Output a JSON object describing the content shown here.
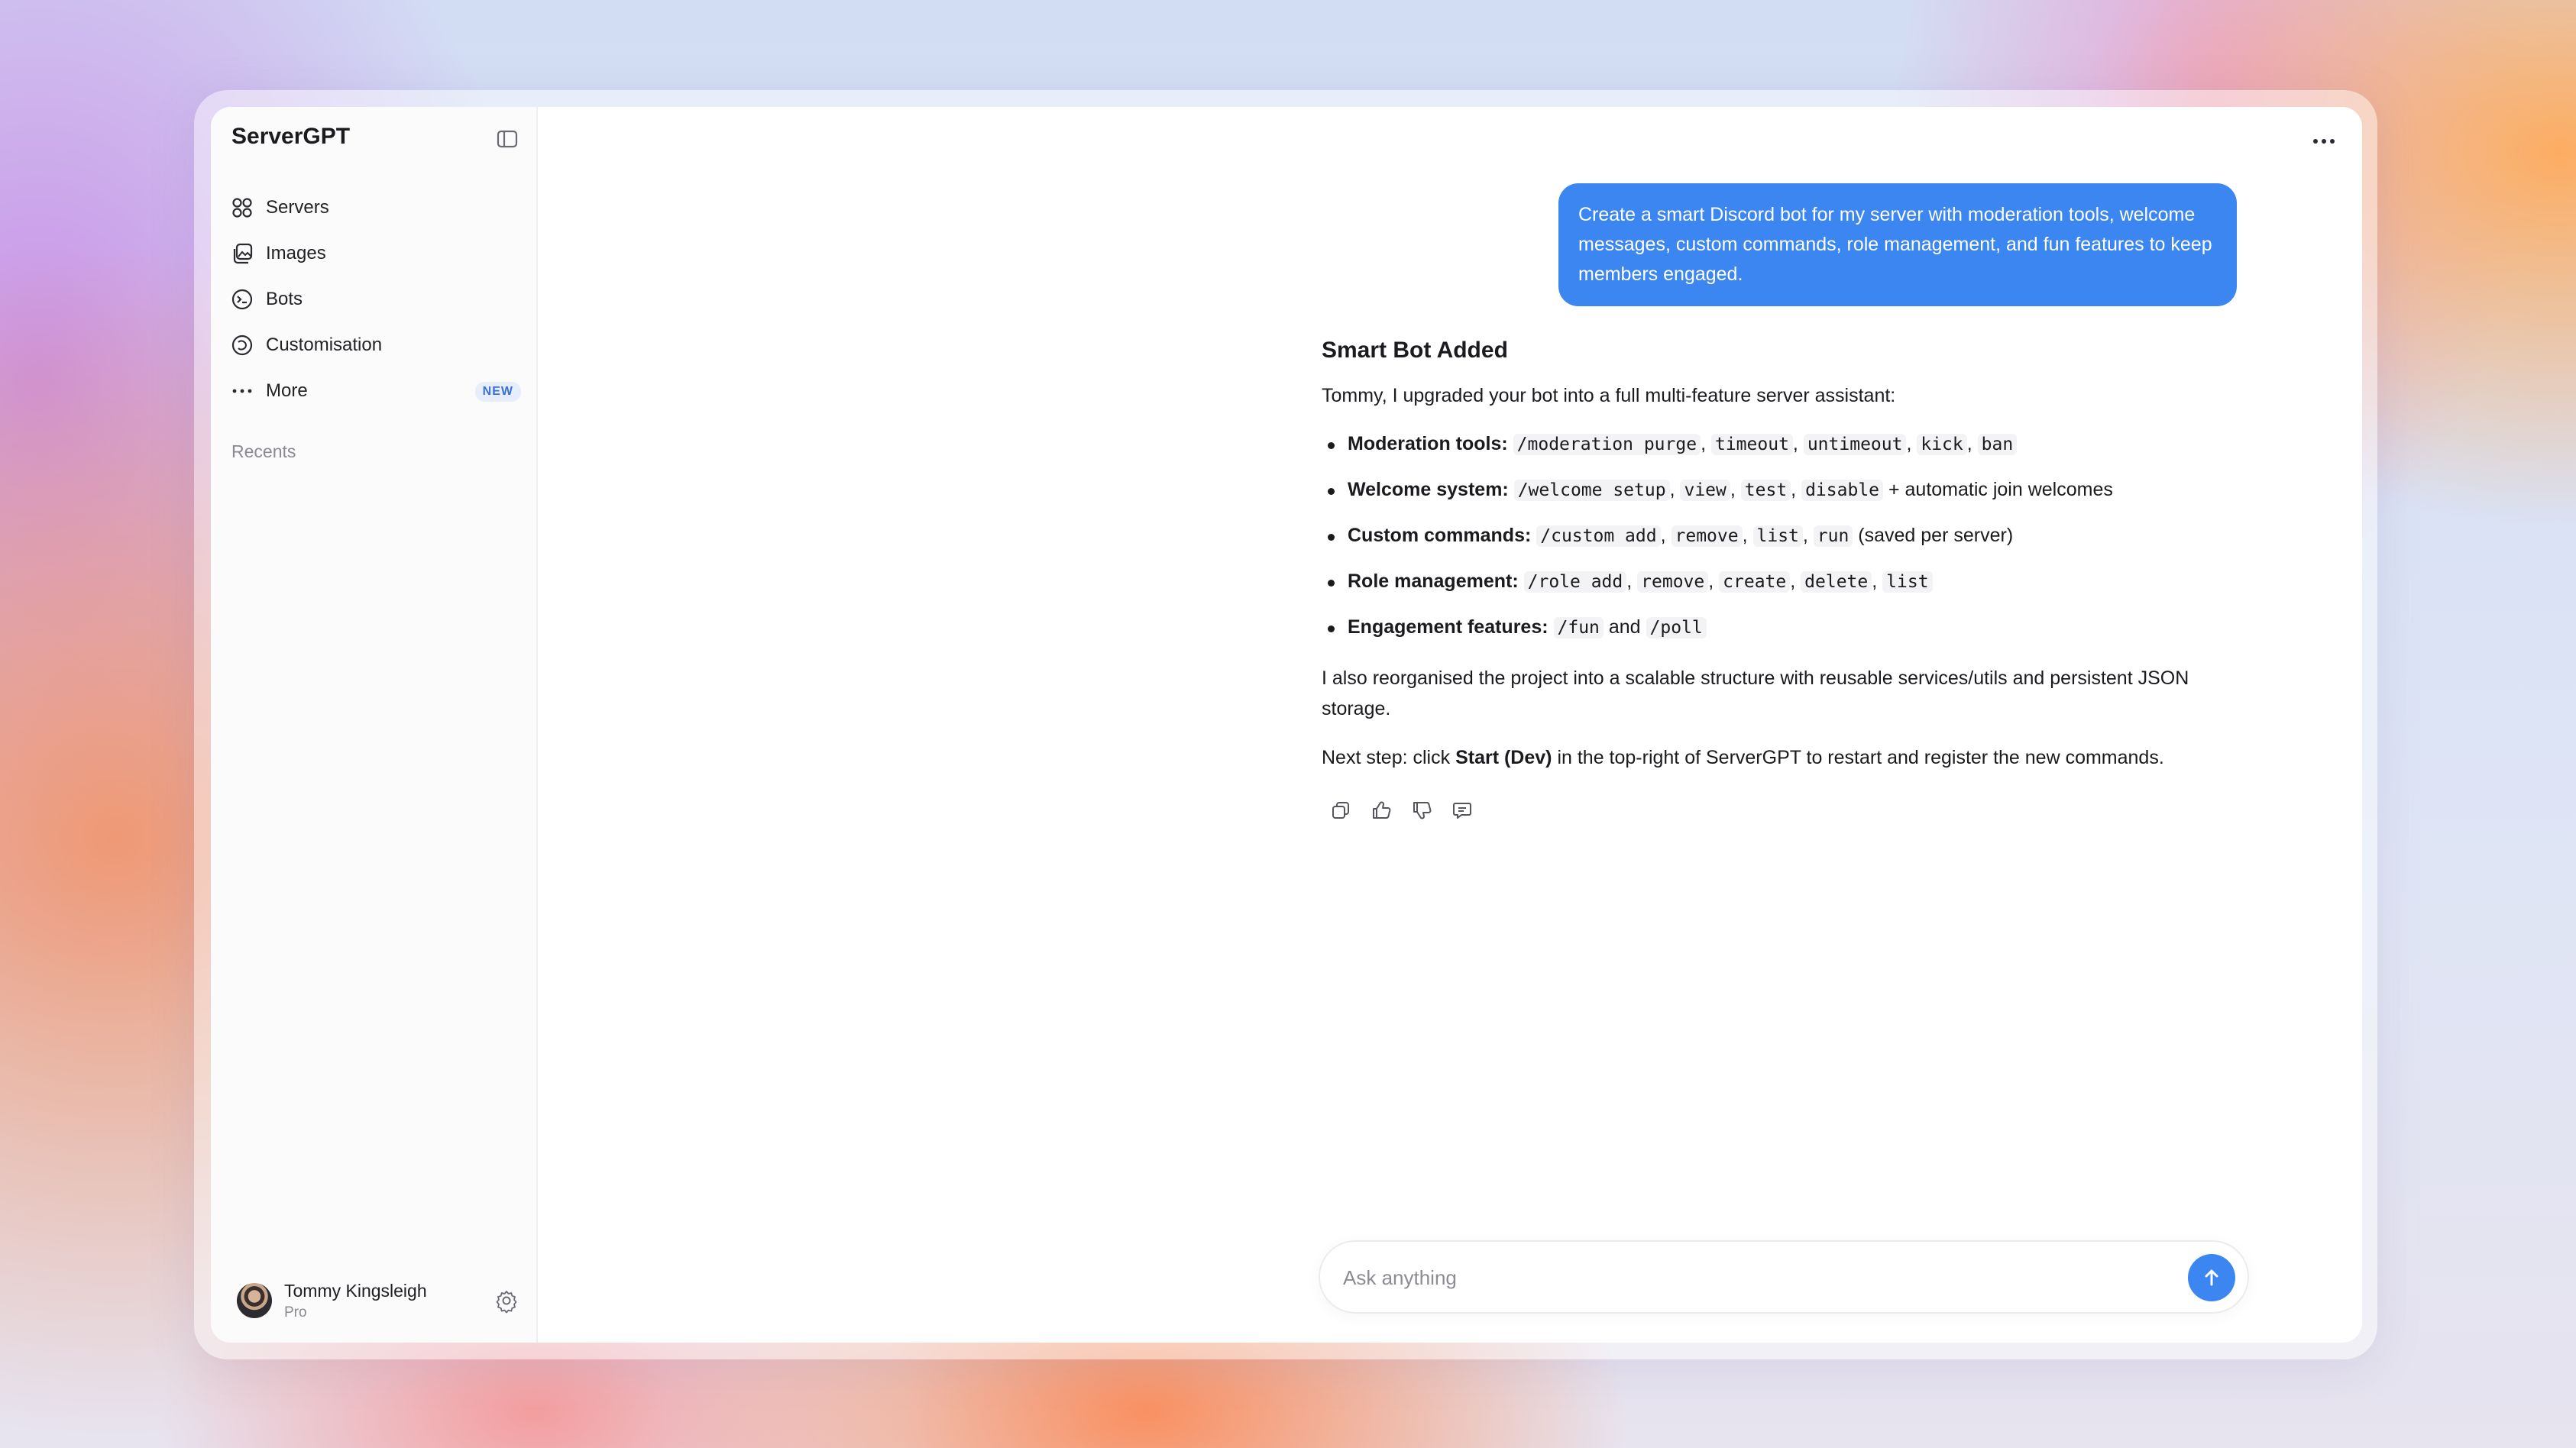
{
  "app": {
    "title": "ServerGPT"
  },
  "sidebar": {
    "items": [
      {
        "label": "Servers",
        "icon": "grid-icon"
      },
      {
        "label": "Images",
        "icon": "images-icon"
      },
      {
        "label": "Bots",
        "icon": "bot-icon"
      },
      {
        "label": "Customisation",
        "icon": "palette-icon"
      },
      {
        "label": "More",
        "icon": "dots-icon",
        "badge": "NEW"
      }
    ],
    "recents_label": "Recents"
  },
  "user": {
    "name": "Tommy Kingsleigh",
    "plan": "Pro"
  },
  "chat": {
    "user_message": "Create a smart Discord bot for my server with moderation tools, welcome messages, custom commands, role management, and fun features to keep members engaged.",
    "answer": {
      "title": "Smart Bot Added",
      "intro": "Tommy, I upgraded your bot into a full multi-feature server assistant:",
      "features": [
        {
          "title": "Moderation tools:",
          "command": "/moderation purge",
          "subs": [
            "timeout",
            "untimeout",
            "kick",
            "ban"
          ],
          "suffix": ""
        },
        {
          "title": "Welcome system:",
          "command": "/welcome setup",
          "subs": [
            "view",
            "test",
            "disable"
          ],
          "suffix": "+ automatic join welcomes"
        },
        {
          "title": "Custom commands:",
          "command": "/custom add",
          "subs": [
            "remove",
            "list",
            "run"
          ],
          "suffix": "(saved per server)"
        },
        {
          "title": "Role management:",
          "command": "/role add",
          "subs": [
            "remove",
            "create",
            "delete",
            "list"
          ],
          "suffix": ""
        }
      ],
      "engagement": {
        "title": "Engagement features:",
        "cmd1": "/fun",
        "joiner": "and",
        "cmd2": "/poll"
      },
      "reorg": "I also reorganised the project into a scalable structure with reusable services/utils and persistent JSON storage.",
      "next_step": {
        "prefix": "Next step: click",
        "bold": "Start (Dev)",
        "suffix": "in the top-right of ServerGPT to restart and register the new commands."
      }
    }
  },
  "composer": {
    "placeholder": "Ask anything"
  },
  "colors": {
    "accent": "#3b86f0",
    "badge_text": "#3a6fd8"
  }
}
